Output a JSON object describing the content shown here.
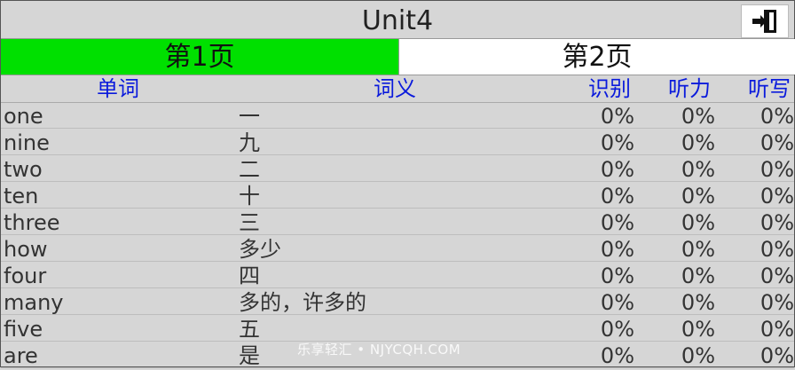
{
  "title": "Unit4",
  "exit_icon": "exit-door-icon",
  "tabs": [
    {
      "label": "第1页",
      "active": true
    },
    {
      "label": "第2页",
      "active": false
    }
  ],
  "columns": {
    "word": "单词",
    "meaning": "词义",
    "recognize": "识别",
    "listen": "听力",
    "write": "听写"
  },
  "rows": [
    {
      "word": "one",
      "meaning": "一",
      "recognize": "0%",
      "listen": "0%",
      "write": "0%"
    },
    {
      "word": "nine",
      "meaning": "九",
      "recognize": "0%",
      "listen": "0%",
      "write": "0%"
    },
    {
      "word": "two",
      "meaning": "二",
      "recognize": "0%",
      "listen": "0%",
      "write": "0%"
    },
    {
      "word": "ten",
      "meaning": "十",
      "recognize": "0%",
      "listen": "0%",
      "write": "0%"
    },
    {
      "word": "three",
      "meaning": "三",
      "recognize": "0%",
      "listen": "0%",
      "write": "0%"
    },
    {
      "word": "how",
      "meaning": "多少",
      "recognize": "0%",
      "listen": "0%",
      "write": "0%"
    },
    {
      "word": "four",
      "meaning": "四",
      "recognize": "0%",
      "listen": "0%",
      "write": "0%"
    },
    {
      "word": "many",
      "meaning": "多的，许多的",
      "recognize": "0%",
      "listen": "0%",
      "write": "0%"
    },
    {
      "word": "five",
      "meaning": "五",
      "recognize": "0%",
      "listen": "0%",
      "write": "0%"
    },
    {
      "word": "are",
      "meaning": "是",
      "recognize": "0%",
      "listen": "0%",
      "write": "0%"
    }
  ],
  "watermark": "乐享轻汇 • NJYCQH.COM",
  "colors": {
    "active_tab": "#00e000",
    "header_text": "#0a1adc",
    "background": "#d6d6d6"
  }
}
